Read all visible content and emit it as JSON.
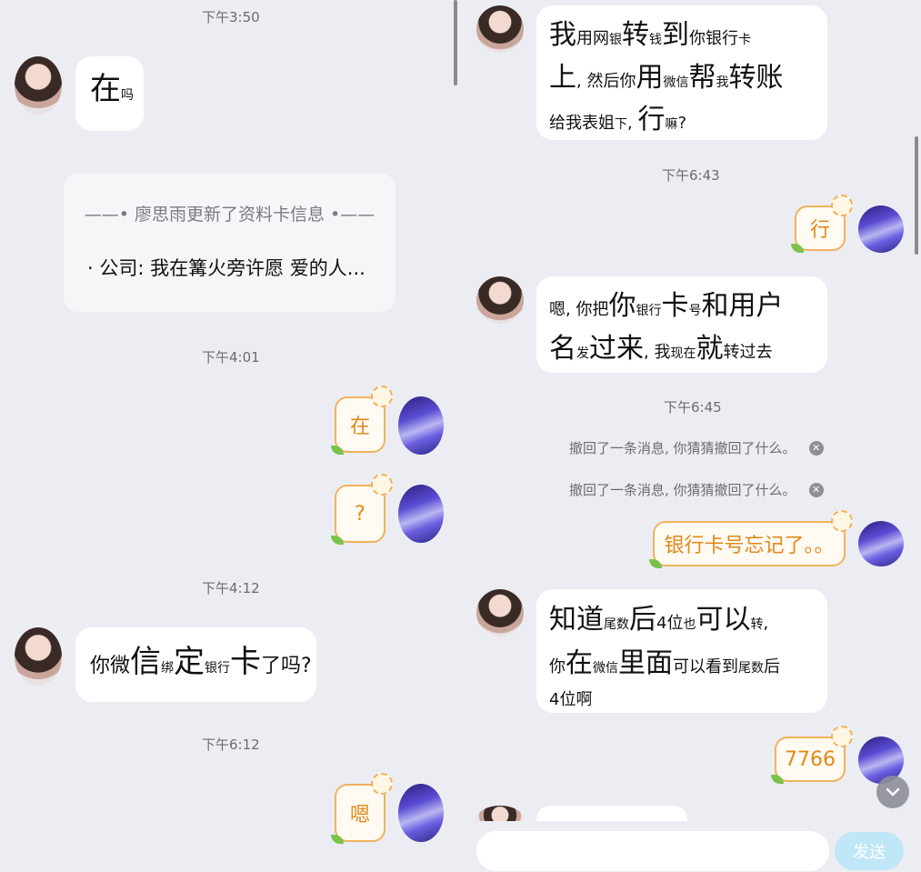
{
  "left": {
    "timestamps": [
      "下午3:50",
      "下午4:01",
      "下午4:12",
      "下午6:12"
    ],
    "msg_zai": {
      "big": "在",
      "small": "吗"
    },
    "profile_card": {
      "title": "——• 廖思雨更新了资料卡信息 •——",
      "body": "· 公司: 我在篝火旁许愿 爱的人..."
    },
    "sticker_zai": "在",
    "sticker_q": "?",
    "msg_bind": {
      "p1": "你微",
      "p2": "信",
      "p3": "绑",
      "p4": "定",
      "p5": "银行",
      "p6": "卡",
      "p7": "了吗?"
    },
    "sticker_en": "嗯"
  },
  "right": {
    "msg_transfer": {
      "l1a": "我",
      "l1b": "用网",
      "l1c": "银",
      "l1d": "转",
      "l1e": "钱",
      "l1f": "到",
      "l1g": "你银行",
      "l1h": "卡",
      "l2a": "上",
      "l2b": ", 然后你",
      "l2c": "用",
      "l2d": "微信",
      "l2e": "帮",
      "l2f": "我",
      "l2g": "转账",
      "l3a": "给我表姐",
      "l3b": "下",
      "l3c": ", ",
      "l3d": "行",
      "l3e": "嘛",
      "l3f": "?"
    },
    "timestamps": [
      "下午6:43",
      "下午6:45"
    ],
    "sticker_xing": "行",
    "msg_send_card": {
      "l1a": "嗯, 你把",
      "l1b": "你",
      "l1c": "银行",
      "l1d": "卡",
      "l1e": "号",
      "l1f": "和用户",
      "l2a": "名",
      "l2b": "发",
      "l2c": "过来",
      "l2d": ", 我",
      "l2e": "现在",
      "l2f": "就",
      "l2g": "转过去"
    },
    "recall_text": "撤回了一条消息, 你猜猜撤回了什么。",
    "sticker_forgot": "银行卡号忘记了。。",
    "msg_last4": {
      "l1a": "知道",
      "l1b": "尾数",
      "l1c": "后",
      "l1d": "4位",
      "l1e": "也",
      "l1f": "可以",
      "l1g": "转",
      "l1h": ",",
      "l2a": "你",
      "l2b": "在",
      "l2c": "微信",
      "l2d": "里面",
      "l2e": "可以看到",
      "l2f": "尾数",
      "l2g": "后",
      "l3a": "4位啊"
    },
    "sticker_7766": "7766",
    "send_label": "发送",
    "input_value": ""
  },
  "icons": {
    "recall_close": "close-icon",
    "jump_down": "chevron-down-icon"
  },
  "colors": {
    "background": "#ecedf2",
    "bubble": "#ffffff",
    "sticker_border": "#f0b25d",
    "sticker_text": "#e08a1b",
    "send_button": "#bfe7f7"
  }
}
